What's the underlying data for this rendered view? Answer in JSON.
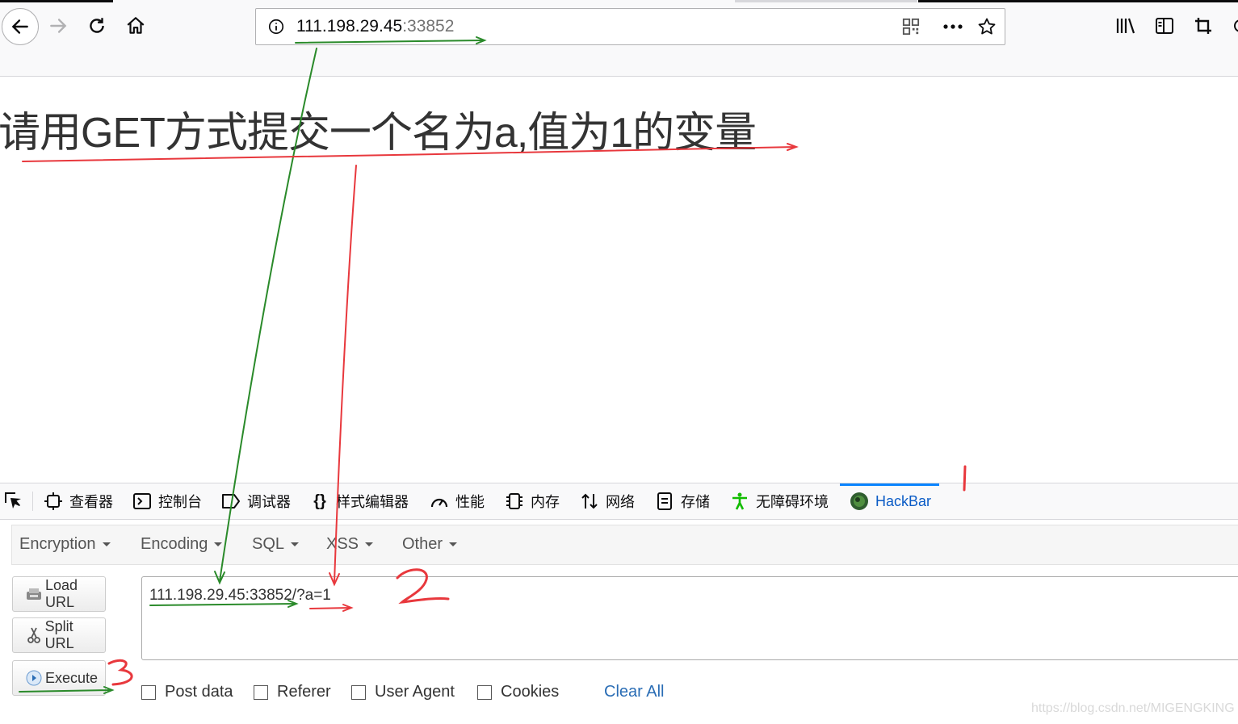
{
  "browser": {
    "address_host": "111.198.29.45",
    "address_port": ":33852"
  },
  "page": {
    "heading": "请用GET方式提交一个名为a,值为1的变量"
  },
  "devtools": {
    "tabs": [
      "查看器",
      "控制台",
      "调试器",
      "样式编辑器",
      "性能",
      "内存",
      "网络",
      "存储",
      "无障碍环境",
      "HackBar"
    ],
    "active_tab": "HackBar"
  },
  "hackbar": {
    "menu": [
      "Encryption",
      "Encoding",
      "SQL",
      "XSS",
      "Other"
    ],
    "buttons": {
      "load": "Load URL",
      "split": "Split URL",
      "execute": "Execute"
    },
    "url_value": "111.198.29.45:33852/?a=1",
    "options": [
      "Post data",
      "Referer",
      "User Agent",
      "Cookies"
    ],
    "clear_all": "Clear All"
  },
  "annotations": {
    "step1": "1",
    "step2": "2",
    "step3": "3"
  },
  "watermark": "https://blog.csdn.net/MIGENGKING",
  "colors": {
    "accent": "#0a84ff",
    "annotation_green": "#2a8a2a",
    "annotation_red": "#e8383d"
  }
}
